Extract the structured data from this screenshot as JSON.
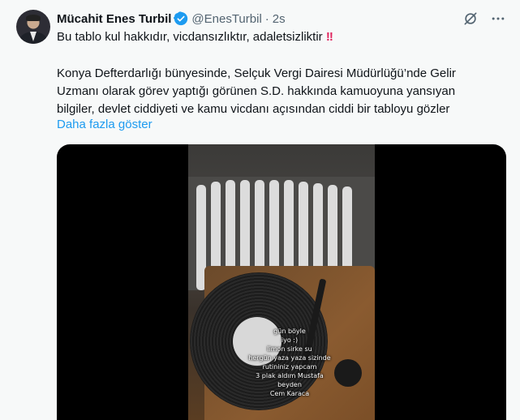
{
  "author": {
    "name": "Mücahit Enes Turbil",
    "handle": "@EnesTurbil",
    "separator": "·",
    "time": "2s"
  },
  "tweet": {
    "line1": "Bu tablo kul hakkıdır, vicdansızlıktır, adaletsizliktir",
    "emphasis": "!!",
    "paragraph": [
      "Konya Defterdarlığı bünyesinde, Selçuk Vergi Dairesi Müdürlüğü’nde Gelir",
      "Uzmanı olarak görev yaptığı görünen S.D. hakkında kamuoyuna yansıyan",
      "bilgiler, devlet ciddiyeti ve kamu vicdanı açısından ciddi bir tabloyu gözler"
    ],
    "show_more": "Daha fazla göster"
  },
  "video_overlay": [
    "gün böyle",
    "iyo :)",
    "limon sirke su",
    "hergün yaza yaza sizinde",
    "rutininiz yapcam",
    "3 plak aldım Mustafa",
    "beyden",
    "Cem Karaca"
  ],
  "icons": {
    "verified": "verified-badge-icon",
    "grok": "grok-icon",
    "more": "more-icon"
  },
  "colors": {
    "verified": "#1d9bf0",
    "link": "#1d9bf0",
    "emphasis": "#e0245e"
  }
}
